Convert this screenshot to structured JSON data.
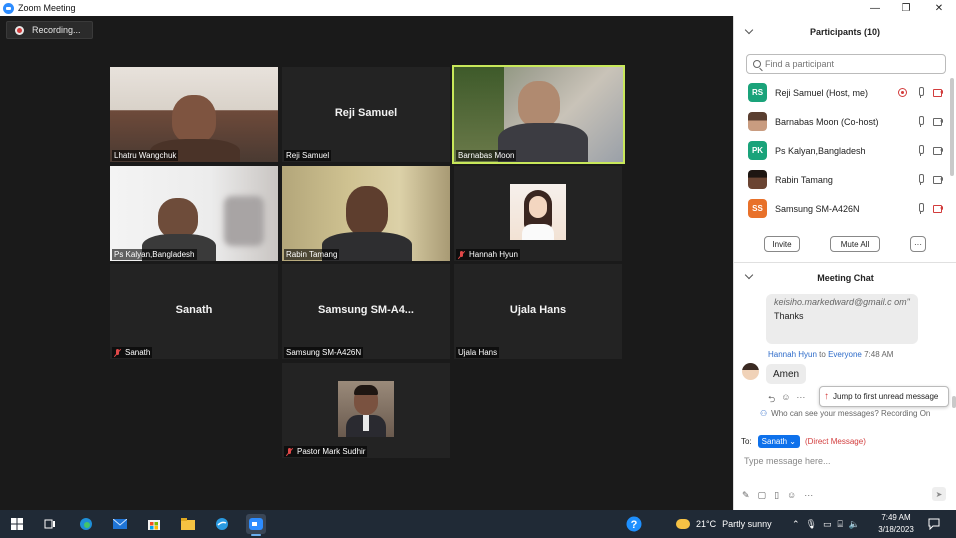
{
  "window": {
    "title": "Zoom Meeting",
    "minimize": "—",
    "maximize": "❐",
    "close": "✕"
  },
  "recording": {
    "label": "Recording..."
  },
  "tiles": [
    {
      "name": "Lhatru Wangchuk",
      "muted": false
    },
    {
      "name": "Reji Samuel",
      "center_name": "Reji Samuel",
      "muted": false
    },
    {
      "name": "Barnabas Moon",
      "muted": false,
      "active_speaker": true
    },
    {
      "name": "Ps Kalyan,Bangladesh",
      "muted": false
    },
    {
      "name": "Rabin Tamang",
      "muted": false
    },
    {
      "name": "Hannah Hyun",
      "muted": true
    },
    {
      "name": "Sanath",
      "center_name": "Sanath",
      "muted": true
    },
    {
      "name": "Samsung SM-A426N",
      "center_name": "Samsung  SM-A4...",
      "muted": false
    },
    {
      "name": "Ujala Hans",
      "center_name": "Ujala Hans",
      "muted": false
    },
    {
      "name": "Pastor Mark Sudhir",
      "muted": true
    }
  ],
  "participants": {
    "title": "Participants (10)",
    "search_placeholder": "Find a participant",
    "list": [
      {
        "initials": "RS",
        "name": "Reji Samuel (Host, me)",
        "color": "#1aa37a",
        "recording": true,
        "video_off": true
      },
      {
        "initials": "",
        "name": "Barnabas Moon (Co-host)",
        "color": "#7a5a44",
        "recording": false,
        "video_off": false
      },
      {
        "initials": "PK",
        "name": "Ps Kalyan,Bangladesh",
        "color": "#1aa37a",
        "recording": false,
        "video_off": false
      },
      {
        "initials": "",
        "name": "Rabin Tamang",
        "color": "#4a3a30",
        "recording": false,
        "video_off": false
      },
      {
        "initials": "SS",
        "name": "Samsung SM-A426N",
        "color": "#e8712a",
        "recording": false,
        "video_off": true
      }
    ],
    "invite_label": "Invite",
    "mute_all_label": "Mute All",
    "more_label": "···"
  },
  "chat": {
    "title": "Meeting Chat",
    "prev_email": "keisiho.markedward@gmail.c om\"",
    "prev_text": "Thanks",
    "sender": "Hannah Hyun",
    "to_word": "to",
    "recipient": "Everyone",
    "time": "7:48 AM",
    "message": "Amen",
    "jump_label": "Jump to first unread message",
    "who_can_see": "Who can see your messages? Recording On",
    "to_label": "To:",
    "to_target": "Sanath",
    "dm_label": "(Direct Message)",
    "input_placeholder": "Type message here..."
  },
  "taskbar": {
    "weather_temp": "21°C",
    "weather_text": "Partly sunny",
    "time": "7:49 AM",
    "date": "3/18/2023"
  }
}
